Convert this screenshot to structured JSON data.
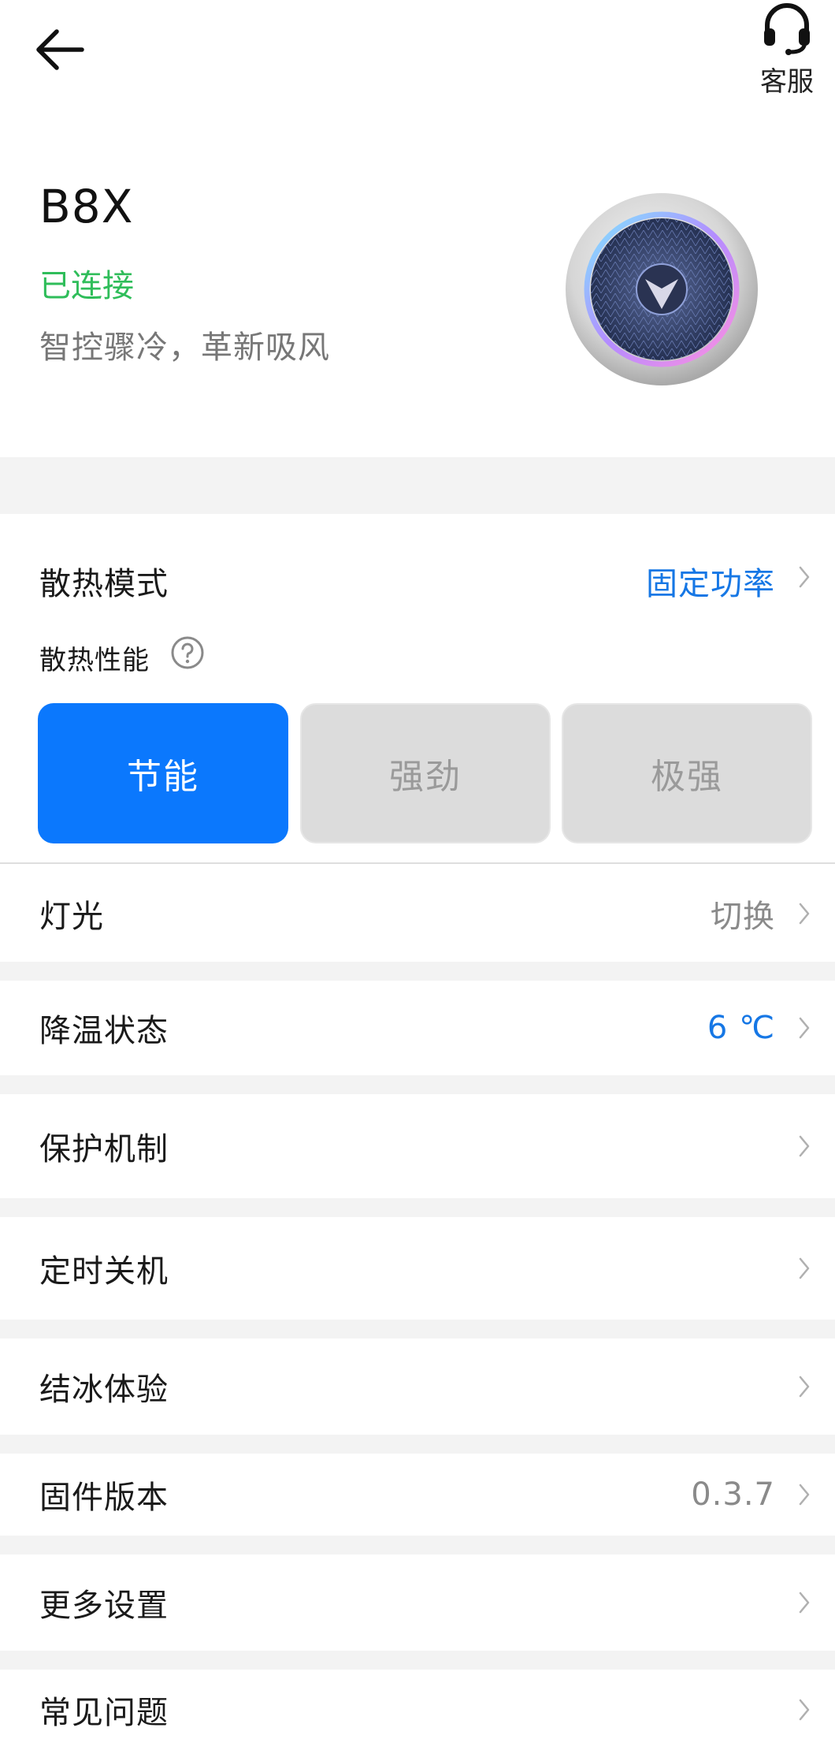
{
  "header": {
    "back_icon": "arrow-left-icon",
    "support_icon": "headset-icon",
    "support_label": "客服"
  },
  "device": {
    "name": "B8X",
    "status": "已连接",
    "slogan": "智控骤冷，革新吸风",
    "status_color": "#2fbd5a"
  },
  "cooling": {
    "mode_label": "散热模式",
    "mode_value": "固定功率",
    "performance_label": "散热性能",
    "help_icon": "question-circle-icon",
    "levels": [
      {
        "label": "节能",
        "selected": true
      },
      {
        "label": "强劲",
        "selected": false
      },
      {
        "label": "极强",
        "selected": false
      }
    ],
    "accent_color": "#0b78fd"
  },
  "settings": {
    "light": {
      "label": "灯光",
      "value": "切换"
    },
    "cooling_status": {
      "label": "降温状态",
      "value": "6 ℃"
    },
    "protection": {
      "label": "保护机制"
    },
    "timer_off": {
      "label": "定时关机"
    },
    "ice_experience": {
      "label": "结冰体验"
    },
    "firmware": {
      "label": "固件版本",
      "value": "0.3.7"
    },
    "more_settings": {
      "label": "更多设置"
    },
    "faq": {
      "label": "常见问题"
    }
  }
}
